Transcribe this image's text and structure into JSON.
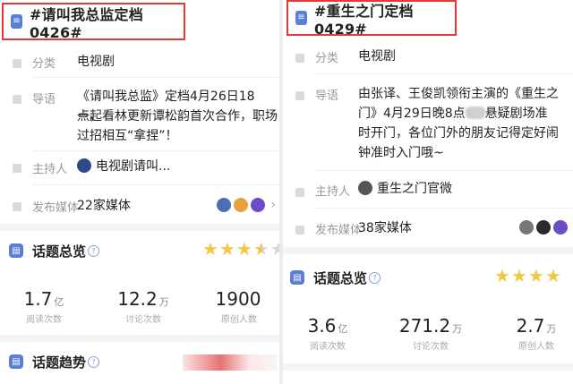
{
  "left": {
    "topic_title": "#请叫我总监定档0426#",
    "category_label": "分类",
    "category_value": "电视剧",
    "intro_label": "导语",
    "intro_lines": [
      "《请叫我总监》定档4月26日18点，",
      "一起看林更新谭松韵首次合作，职场",
      "过招相互“拿捏”！"
    ],
    "host_label": "主持人",
    "host_value": "电视剧请叫...",
    "media_label": "发布媒体",
    "media_value": "22家媒体",
    "overview_title": "话题总览",
    "stars": 3.5,
    "stats": [
      {
        "num": "1.7",
        "unit": "亿",
        "label": "阅读次数"
      },
      {
        "num": "12.2",
        "unit": "万",
        "label": "讨论次数"
      },
      {
        "num": "1900",
        "unit": "",
        "label": "原创人数"
      }
    ],
    "trend_title": "话题趋势"
  },
  "right": {
    "topic_title": "#重生之门定档0429#",
    "category_label": "分类",
    "category_value": "电视剧",
    "intro_label": "导语",
    "intro_lines": [
      "由张译、王俊凯领衔主演的《重生之",
      "门》4月29日晚8点",
      "悬疑剧场准",
      "时开门，各位门外的朋友记得定好闹",
      "钟准时入门哦~"
    ],
    "host_label": "主持人",
    "host_value": "重生之门官微",
    "media_label": "发布媒体",
    "media_value": "38家媒体",
    "overview_title": "话题总览",
    "stats": [
      {
        "num": "3.6",
        "unit": "亿",
        "label": "阅读次数"
      },
      {
        "num": "271.2",
        "unit": "万",
        "label": "讨论次数"
      },
      {
        "num": "2.7",
        "unit": "万",
        "label": "原创人数"
      }
    ]
  },
  "icons": {
    "title": "note-icon",
    "section": "chart-icon",
    "help": "question-icon",
    "chevron": "chevron-right-icon"
  },
  "colors": {
    "highlight_border": "#e53935",
    "accent": "#5b7fd6",
    "star": "#f2c744"
  },
  "glyphs": {
    "chevron": "›",
    "help": "?",
    "star": "★"
  }
}
